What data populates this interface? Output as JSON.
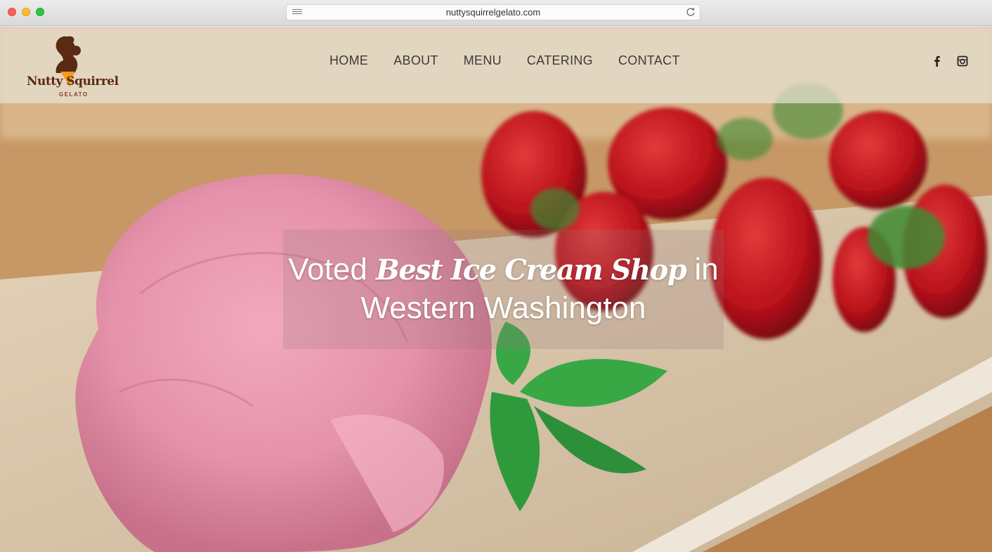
{
  "browser": {
    "url": "nuttysquirrelgelato.com"
  },
  "header": {
    "logo": {
      "name": "Nutty Squirrel",
      "sub": "GELATO"
    },
    "nav": [
      {
        "label": "HOME"
      },
      {
        "label": "ABOUT"
      },
      {
        "label": "MENU"
      },
      {
        "label": "CATERING"
      },
      {
        "label": "CONTACT"
      }
    ],
    "social": [
      {
        "icon": "facebook-icon"
      },
      {
        "icon": "instagram-icon"
      }
    ]
  },
  "hero": {
    "line1_prefix": "Voted ",
    "line1_highlight": "Best Ice Cream Shop",
    "line1_suffix": " in",
    "line2": "Western Washington"
  },
  "colors": {
    "brand_brown": "#5a2a12",
    "nav_text": "#3d3a37",
    "headline_text": "#ffffff"
  }
}
